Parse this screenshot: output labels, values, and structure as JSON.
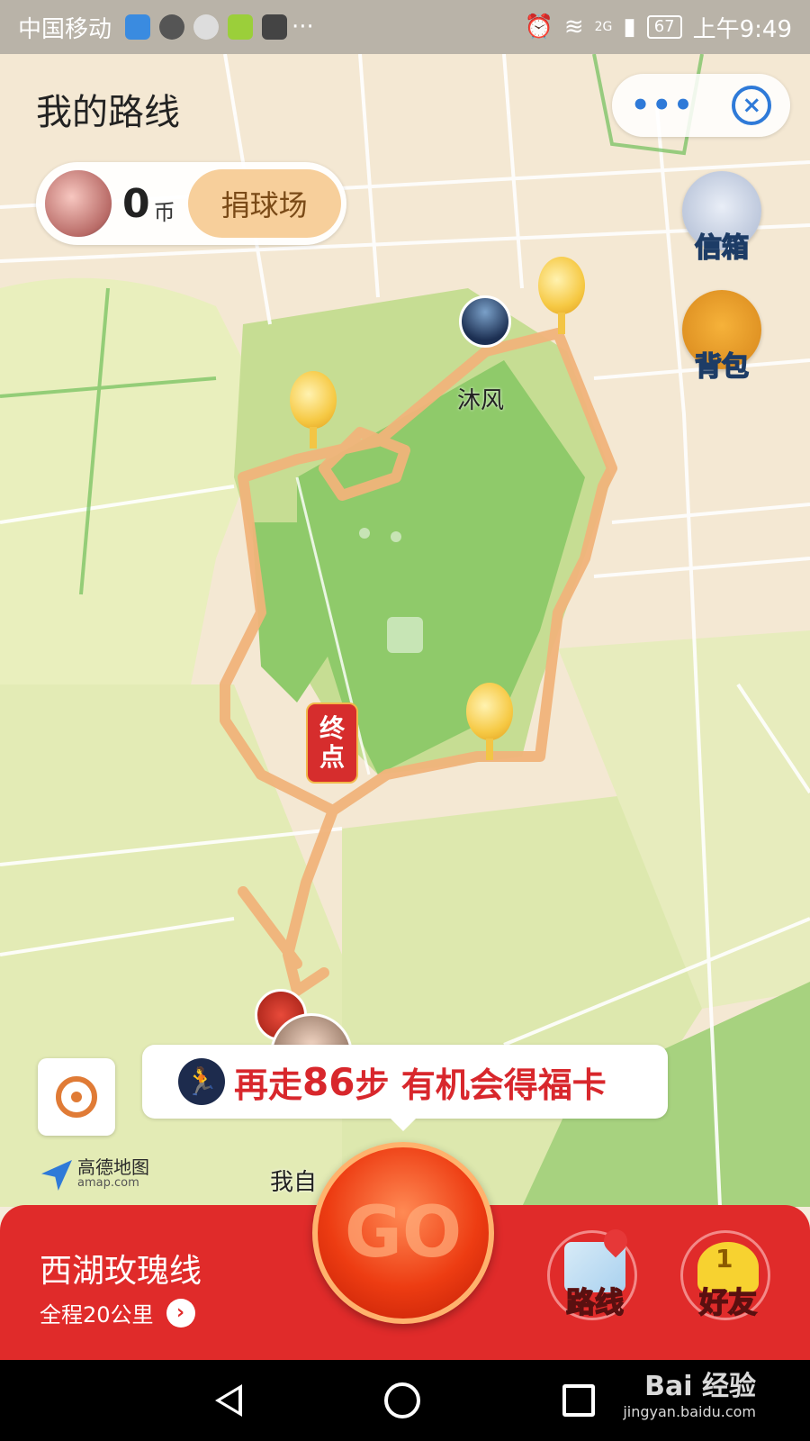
{
  "status_bar": {
    "carrier": "中国移动",
    "network": "2G",
    "battery": "67",
    "time": "上午9:49",
    "icons": [
      "shield-icon",
      "browser-icon",
      "qq-icon",
      "music-icon",
      "toutiao-icon",
      "more-dots-icon"
    ]
  },
  "header": {
    "title": "我的路线",
    "more_icon": "more-icon",
    "close_icon": "close-icon"
  },
  "coins": {
    "count": "0",
    "unit": "币",
    "donate_label": "捐球场"
  },
  "side_buttons": {
    "mailbox_label": "信箱",
    "backpack_label": "背包"
  },
  "map": {
    "friend_name": "沐风",
    "end_label_1": "终",
    "end_label_2": "点",
    "self_name": "我自",
    "amap_brand": "高德地图",
    "amap_url": "amap.com"
  },
  "tip": {
    "prefix": "再走",
    "steps": "86",
    "suffix": "步 有机会得福卡"
  },
  "route": {
    "name": "西湖玫瑰线",
    "distance": "全程20公里"
  },
  "go_button": {
    "label": "GO"
  },
  "bottom_icons": {
    "route_label": "路线",
    "friends_label": "好友",
    "friends_badge": "1"
  },
  "watermark": {
    "brand": "Bai 经验",
    "url": "jingyan.baidu.com"
  },
  "colors": {
    "accent_red": "#e02b2a",
    "route_line": "#f0b37a",
    "lake_green": "#8fca6a",
    "blue_icon": "#2f7ad8"
  }
}
